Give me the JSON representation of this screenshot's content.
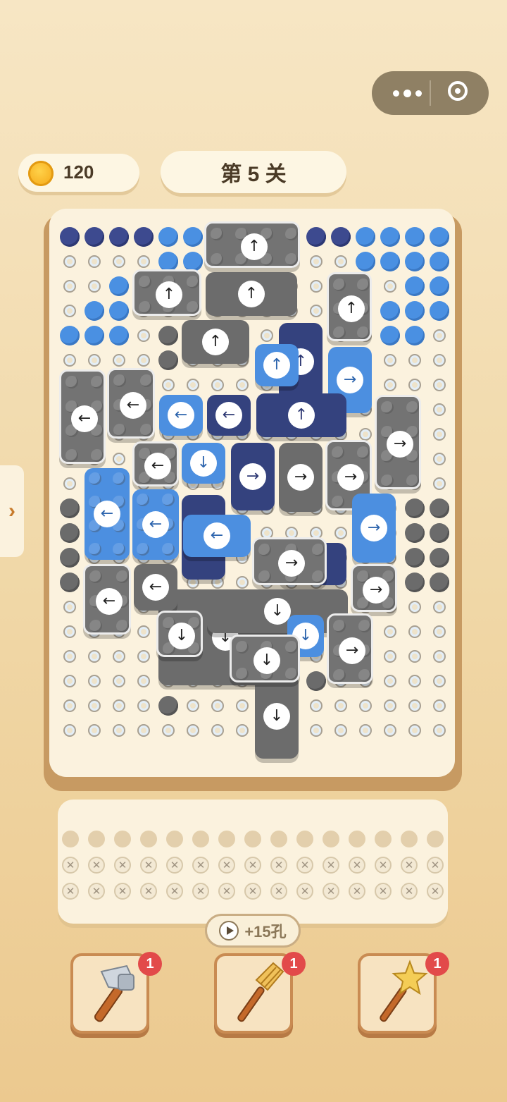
{
  "header": {
    "coins": "120",
    "level": "第 5 关"
  },
  "tray": {
    "ad_button_label": "+15孔",
    "open_slots": 15,
    "locked_rows": 2
  },
  "tools": [
    {
      "name": "hammer",
      "count": "1"
    },
    {
      "name": "broom",
      "count": "1"
    },
    {
      "name": "magic-wand",
      "count": "1"
    }
  ],
  "colors": {
    "navy": "#34427e",
    "blue": "#4c8fe0",
    "gray": "#6c6c6c",
    "badge": "#e24a4a"
  }
}
